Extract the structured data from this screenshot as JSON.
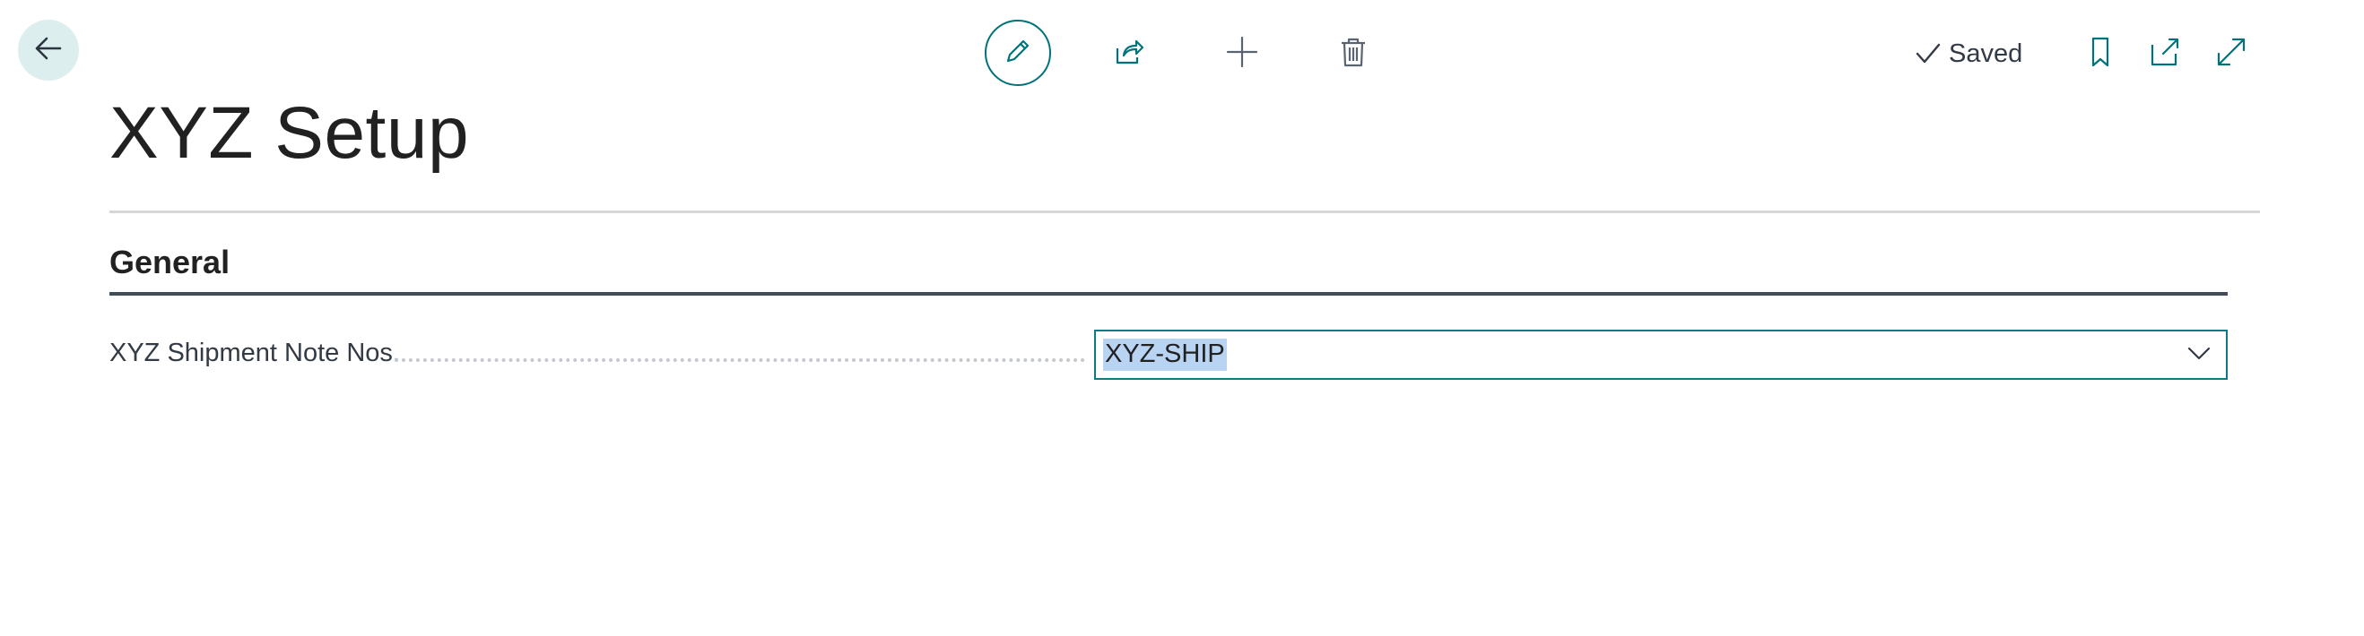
{
  "header": {
    "back_icon": "arrow-left-icon",
    "actions": [
      {
        "name": "edit",
        "icon": "pencil-icon"
      },
      {
        "name": "share",
        "icon": "share-icon"
      },
      {
        "name": "new",
        "icon": "plus-icon"
      },
      {
        "name": "delete",
        "icon": "trash-icon"
      }
    ],
    "status_text": "Saved",
    "status_icon": "check-icon",
    "right_icons": [
      "bookmark-icon",
      "open-new-window-icon",
      "expand-icon"
    ]
  },
  "page": {
    "title": "XYZ Setup"
  },
  "sections": [
    {
      "title": "General",
      "fields": [
        {
          "label": "XYZ Shipment Note Nos.",
          "value": "XYZ-SHIP",
          "dropdown_icon": "chevron-down-icon"
        }
      ]
    }
  ],
  "colors": {
    "accent": "#00727b",
    "back_bg": "#dcefee",
    "selection": "#b9d4f3",
    "section_rule": "#414a57"
  }
}
